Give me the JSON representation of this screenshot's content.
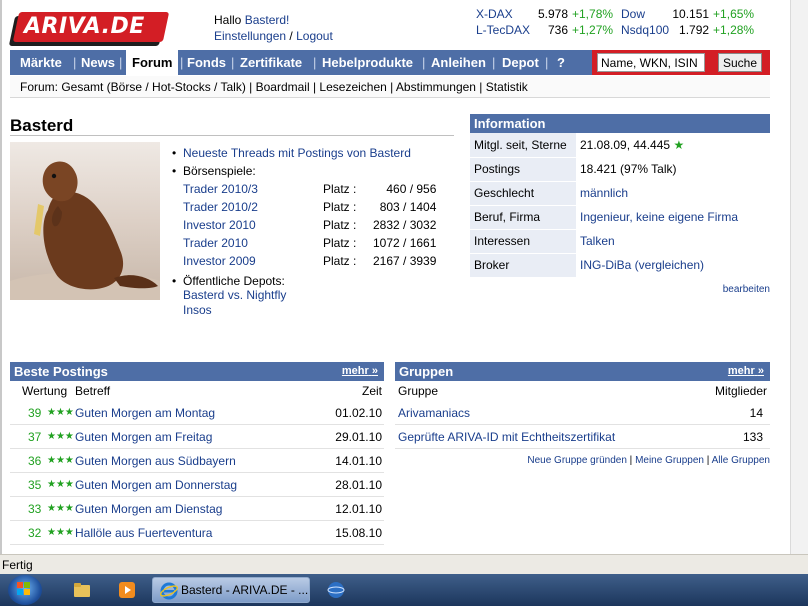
{
  "brand": {
    "logo": "ARIVA.DE",
    "accent": "#d31e25",
    "nav_blue": "#4e6ea6",
    "positive_green": "#21a121"
  },
  "greeting": {
    "hello": "Hallo",
    "user": "Basterd!",
    "settings": "Einstellungen",
    "slash": "/",
    "logout": "Logout"
  },
  "ticker": [
    {
      "name": "X-DAX",
      "value": "5.978",
      "change": "+1,78%"
    },
    {
      "name": "Dow",
      "value": "10.151",
      "change": "+1,65%"
    },
    {
      "name": "L-TecDAX",
      "value": "736",
      "change": "+1,27%"
    },
    {
      "name": "Nsdq100",
      "value": "1.792",
      "change": "+1,28%"
    }
  ],
  "nav": {
    "items": [
      "Märkte",
      "News",
      "Forum",
      "Fonds",
      "Zertifikate",
      "Hebelprodukte",
      "Anleihen",
      "Depot",
      "?"
    ],
    "active": "Forum",
    "search_placeholder": "Name, WKN, ISIN",
    "search_value": "Name, WKN, ISIN",
    "search_button": "Suche"
  },
  "subnav": {
    "text": "Forum: Gesamt (Börse / Hot-Stocks / Talk) | Boardmail | Lesezeichen | Abstimmungen | Statistik"
  },
  "profile": {
    "name": "Basterd",
    "newest_threads": "Neueste Threads mit Postings von Basterd",
    "games_label": "Börsenspiele:",
    "games": [
      {
        "name": "Trader 2010/3",
        "platz": "Platz :",
        "rank": "460 / 956"
      },
      {
        "name": "Trader 2010/2",
        "platz": "Platz :",
        "rank": "803 / 1404"
      },
      {
        "name": "Investor 2010",
        "platz": "Platz :",
        "rank": "2832 / 3032"
      },
      {
        "name": "Trader 2010",
        "platz": "Platz :",
        "rank": "1072 / 1661"
      },
      {
        "name": "Investor 2009",
        "platz": "Platz :",
        "rank": "2167 / 3939"
      }
    ],
    "depots_label": "Öffentliche Depots:",
    "depots": [
      "Basterd vs. Nightfly",
      "Insos"
    ]
  },
  "information": {
    "title": "Information",
    "rows": [
      {
        "key": "Mitgl. seit, Sterne",
        "value": "21.08.09, 44.445",
        "star": true
      },
      {
        "key": "Postings",
        "value": "18.421 (97% Talk)"
      },
      {
        "key": "Geschlecht",
        "value": "männlich",
        "link": true
      },
      {
        "key": "Beruf, Firma",
        "value": "Ingenieur, keine eigene Firma",
        "link": true
      },
      {
        "key": "Interessen",
        "value": "Talken",
        "link": true
      },
      {
        "key": "Broker",
        "value": "ING-DiBa (vergleichen)",
        "link": true
      }
    ],
    "edit": "bearbeiten"
  },
  "best_postings": {
    "title": "Beste Postings",
    "more": "mehr",
    "col_rating": "Wertung",
    "col_subject": "Betreff",
    "col_time": "Zeit",
    "rows": [
      {
        "rating": "39",
        "subject": "Guten Morgen am Montag",
        "time": "01.02.10"
      },
      {
        "rating": "37",
        "subject": "Guten Morgen am Freitag",
        "time": "29.01.10"
      },
      {
        "rating": "36",
        "subject": "Guten Morgen aus Südbayern",
        "time": "14.01.10"
      },
      {
        "rating": "35",
        "subject": "Guten Morgen am Donnerstag",
        "time": "28.01.10"
      },
      {
        "rating": "33",
        "subject": "Guten Morgen am Dienstag",
        "time": "12.01.10"
      },
      {
        "rating": "32",
        "subject": "Hallöle aus Fuerteventura",
        "time": "15.08.10"
      }
    ]
  },
  "groups": {
    "title": "Gruppen",
    "more": "mehr",
    "col_group": "Gruppe",
    "col_members": "Mitglieder",
    "rows": [
      {
        "name": "Arivamaniacs",
        "members": "14"
      },
      {
        "name": "Geprüfte ARIVA-ID mit Echtheitszertifikat",
        "members": "133"
      }
    ],
    "new_group": "Neue Gruppe gründen",
    "my_groups": "Meine Gruppen",
    "all_groups": "Alle Gruppen",
    "sep": "|"
  },
  "status": {
    "text": "Fertig"
  },
  "taskbar": {
    "window_title": "Basterd - ARIVA.DE - ..."
  }
}
